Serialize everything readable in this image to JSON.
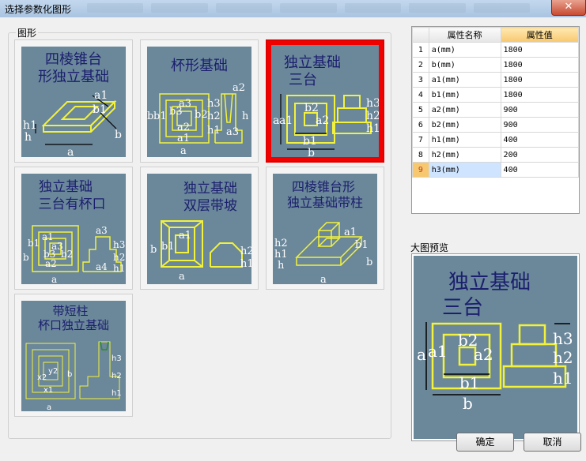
{
  "window": {
    "title": "选择参数化图形",
    "close_glyph": "✕"
  },
  "shapes_group": {
    "label": "图形",
    "tiles": [
      {
        "title_lines": [
          "四棱锥台",
          "形独立基础"
        ],
        "dims": [
          "a1",
          "b1",
          "b",
          "a",
          "h1",
          "h"
        ]
      },
      {
        "title_lines": [
          "杯形基础"
        ],
        "dims": [
          "a2",
          "a3",
          "b3",
          "b2",
          "b1",
          "a2",
          "a1",
          "a",
          "b",
          "h3",
          "h2",
          "h1",
          "h",
          "a3"
        ]
      },
      {
        "title_lines": [
          "独立基础",
          "三台"
        ],
        "dims": [
          "a",
          "a1",
          "b2",
          "a2",
          "b1",
          "b",
          "h3",
          "h2",
          "h1"
        ],
        "selected": true
      },
      {
        "title_lines": [
          "独立基础",
          "三台有杯口"
        ],
        "dims": [
          "a3",
          "b1",
          "a1",
          "a3",
          "b3",
          "b2",
          "a2",
          "a",
          "b",
          "a4",
          "h3",
          "h2",
          "h1"
        ]
      },
      {
        "title_lines": [
          "独立基础",
          "双层带坡"
        ],
        "dims": [
          "a1",
          "b1",
          "b",
          "a",
          "h2",
          "h1"
        ]
      },
      {
        "title_lines": [
          "四棱锥台形",
          "独立基础带柱"
        ],
        "dims": [
          "a1",
          "b1",
          "h2",
          "h1",
          "h",
          "b",
          "a"
        ]
      },
      {
        "title_lines": [
          "带短柱",
          "杯口独立基础"
        ],
        "dims": [
          "x2",
          "y2",
          "b",
          "x1",
          "a",
          "h3",
          "h2",
          "h1"
        ]
      }
    ]
  },
  "property_grid": {
    "headers": [
      "",
      "属性名称",
      "属性值"
    ],
    "rows": [
      {
        "index": "1",
        "name": "a(mm)",
        "value": "1800"
      },
      {
        "index": "2",
        "name": "b(mm)",
        "value": "1800"
      },
      {
        "index": "3",
        "name": "a1(mm)",
        "value": "1800"
      },
      {
        "index": "4",
        "name": "b1(mm)",
        "value": "1800"
      },
      {
        "index": "5",
        "name": "a2(mm)",
        "value": "900"
      },
      {
        "index": "6",
        "name": "b2(mm)",
        "value": "900"
      },
      {
        "index": "7",
        "name": "h1(mm)",
        "value": "400"
      },
      {
        "index": "8",
        "name": "h2(mm)",
        "value": "200"
      },
      {
        "index": "9",
        "name": "h3(mm)",
        "value": "400"
      }
    ]
  },
  "preview": {
    "label": "大图预览",
    "title_lines": [
      "独立基础",
      "三台"
    ],
    "dims": [
      "a",
      "a1",
      "b2",
      "a2",
      "b1",
      "b",
      "h3",
      "h2",
      "h1"
    ]
  },
  "buttons": {
    "ok": "确定",
    "cancel": "取消"
  },
  "colors": {
    "thumb_bg": "#6b879a",
    "drawing_line": "#f2f23c",
    "selected_border": "#f10000",
    "title_text": "#1a1f6e"
  }
}
